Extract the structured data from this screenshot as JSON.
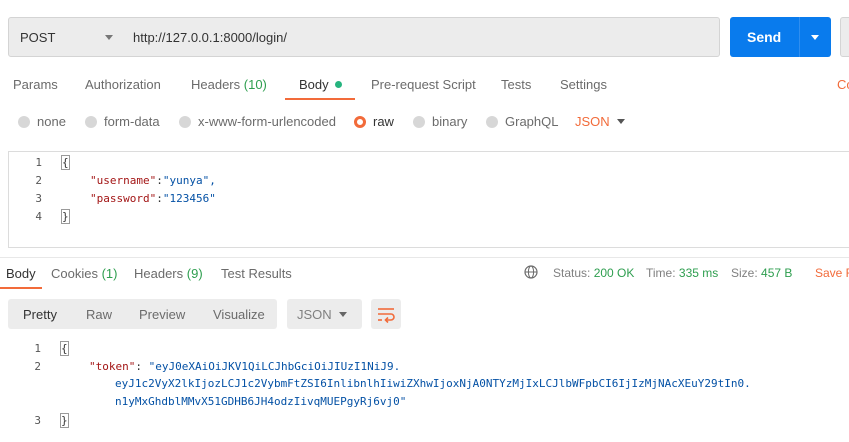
{
  "request": {
    "method": "POST",
    "url": "http://127.0.0.1:8000/login/",
    "send_label": "Send"
  },
  "request_tabs": {
    "params": "Params",
    "authorization": "Authorization",
    "headers": "Headers",
    "headers_count": "(10)",
    "body": "Body",
    "pre_request": "Pre-request Script",
    "tests": "Tests",
    "settings": "Settings",
    "cookies_cut": "Co"
  },
  "body_types": {
    "none": "none",
    "form_data": "form-data",
    "urlencoded": "x-www-form-urlencoded",
    "raw": "raw",
    "binary": "binary",
    "graphql": "GraphQL",
    "format": "JSON"
  },
  "request_body": {
    "lines": [
      {
        "num": "1",
        "text": "{"
      },
      {
        "num": "2",
        "key": "\"username\"",
        "sep": ":",
        "value": "\"yunya\","
      },
      {
        "num": "3",
        "key": "\"password\"",
        "sep": ":",
        "value": "\"123456\""
      },
      {
        "num": "4",
        "text": "}"
      }
    ]
  },
  "response_tabs": {
    "body": "Body",
    "cookies": "Cookies",
    "cookies_count": "(1)",
    "headers": "Headers",
    "headers_count": "(9)",
    "test_results": "Test Results"
  },
  "response_meta": {
    "status_label": "Status:",
    "status_value": "200 OK",
    "time_label": "Time:",
    "time_value": "335 ms",
    "size_label": "Size:",
    "size_value": "457 B",
    "save_cut": "Save R"
  },
  "response_view": {
    "pretty": "Pretty",
    "raw": "Raw",
    "preview": "Preview",
    "visualize": "Visualize",
    "format": "JSON"
  },
  "response_body": {
    "l1_num": "1",
    "l1_text": "{",
    "l2_num": "2",
    "token_key": "\"token\"",
    "token_sep": ": ",
    "token_part1": "\"eyJ0eXAiOiJKV1QiLCJhbGciOiJIUzI1NiJ9.",
    "token_part2": "eyJ1c2VyX2lkIjozLCJ1c2VybmFtZSI6InlibnlhIiwiZXhwIjoxNjA0NTYzMjIxLCJlbWFpbCI6IjIzMjNAcXEuY29tIn0.",
    "token_part3": "n1yMxGhdblMMvX51GDHB6JH4odzIivqMUEPgyRj6vj0\"",
    "l3_num": "3",
    "l3_text": "}"
  },
  "colors": {
    "accent_orange": "#f26b3a",
    "send_blue": "#097bed",
    "status_green": "#2e9e4f"
  }
}
